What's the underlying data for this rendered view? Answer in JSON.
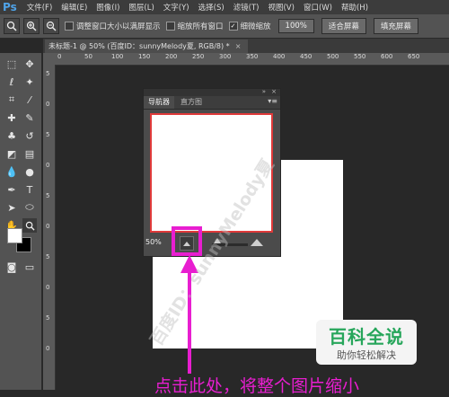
{
  "app": {
    "logo": "Ps"
  },
  "menu": [
    "文件(F)",
    "编辑(E)",
    "图像(I)",
    "图层(L)",
    "文字(Y)",
    "选择(S)",
    "滤镜(T)",
    "视图(V)",
    "窗口(W)",
    "帮助(H)"
  ],
  "options_bar": {
    "resize_windows_label": "调整窗口大小以满屏显示",
    "zoom_all_windows_label": "缩放所有窗口",
    "scrubby_zoom_label": "细微缩放",
    "actual_pixels_label": "100%",
    "fit_screen_label": "适合屏幕",
    "fill_screen_label": "填充屏幕"
  },
  "document_tab": {
    "title": "未标题-1 @ 50% (百度ID：sunnyMelody夏, RGB/8) *"
  },
  "ruler_h_ticks": [
    "0",
    "50",
    "100",
    "150",
    "200",
    "250",
    "300",
    "350",
    "400",
    "450",
    "500",
    "550",
    "600",
    "650"
  ],
  "ruler_v_ticks": [
    "5",
    "0",
    "5",
    "0",
    "5",
    "0",
    "5",
    "0",
    "5",
    "0"
  ],
  "navigator": {
    "tabs": [
      "导航器",
      "直方图"
    ],
    "zoom_value": "50%"
  },
  "watermark_text": "百度ID：sunnyMelody夏",
  "brand": {
    "title": "百科全说",
    "subtitle": "助你轻松解决"
  },
  "caption": "点击此处，将整个图片缩小",
  "colors": {
    "highlight": "#e81ed0",
    "brand_green": "#27a65b",
    "preview_border": "#e03a3a"
  }
}
